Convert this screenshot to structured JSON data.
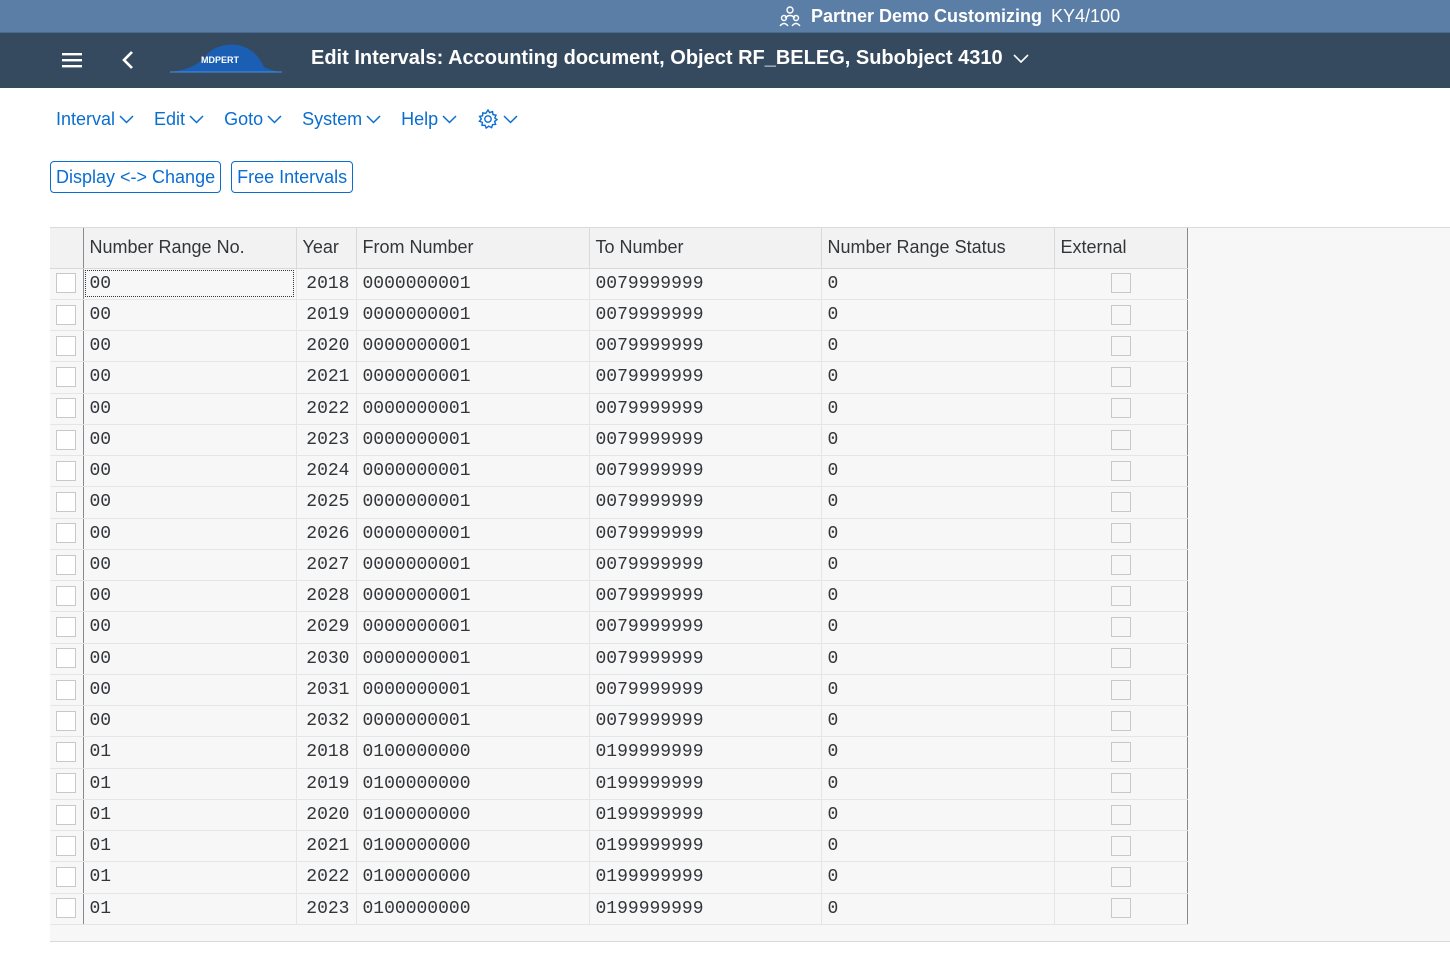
{
  "system_bar": {
    "system_name": "Partner Demo Customizing",
    "client": "KY4/100"
  },
  "shell": {
    "logo_text": "MDPERT",
    "title": "Edit Intervals: Accounting document, Object RF_BELEG, Subobject 4310"
  },
  "menu": [
    {
      "label": "Interval"
    },
    {
      "label": "Edit"
    },
    {
      "label": "Goto"
    },
    {
      "label": "System"
    },
    {
      "label": "Help"
    }
  ],
  "toolbar": {
    "display_change_label": "Display <-> Change",
    "free_intervals_label": "Free Intervals"
  },
  "table": {
    "columns": [
      "Number Range No.",
      "Year",
      "From Number",
      "To Number",
      "Number Range Status",
      "External"
    ],
    "rows": [
      [
        "00",
        "2018",
        "0000000001",
        "0079999999",
        "0"
      ],
      [
        "00",
        "2019",
        "0000000001",
        "0079999999",
        "0"
      ],
      [
        "00",
        "2020",
        "0000000001",
        "0079999999",
        "0"
      ],
      [
        "00",
        "2021",
        "0000000001",
        "0079999999",
        "0"
      ],
      [
        "00",
        "2022",
        "0000000001",
        "0079999999",
        "0"
      ],
      [
        "00",
        "2023",
        "0000000001",
        "0079999999",
        "0"
      ],
      [
        "00",
        "2024",
        "0000000001",
        "0079999999",
        "0"
      ],
      [
        "00",
        "2025",
        "0000000001",
        "0079999999",
        "0"
      ],
      [
        "00",
        "2026",
        "0000000001",
        "0079999999",
        "0"
      ],
      [
        "00",
        "2027",
        "0000000001",
        "0079999999",
        "0"
      ],
      [
        "00",
        "2028",
        "0000000001",
        "0079999999",
        "0"
      ],
      [
        "00",
        "2029",
        "0000000001",
        "0079999999",
        "0"
      ],
      [
        "00",
        "2030",
        "0000000001",
        "0079999999",
        "0"
      ],
      [
        "00",
        "2031",
        "0000000001",
        "0079999999",
        "0"
      ],
      [
        "00",
        "2032",
        "0000000001",
        "0079999999",
        "0"
      ],
      [
        "01",
        "2018",
        "0100000000",
        "0199999999",
        "0"
      ],
      [
        "01",
        "2019",
        "0100000000",
        "0199999999",
        "0"
      ],
      [
        "01",
        "2020",
        "0100000000",
        "0199999999",
        "0"
      ],
      [
        "01",
        "2021",
        "0100000000",
        "0199999999",
        "0"
      ],
      [
        "01",
        "2022",
        "0100000000",
        "0199999999",
        "0"
      ],
      [
        "01",
        "2023",
        "0100000000",
        "0199999999",
        "0"
      ]
    ]
  },
  "colors": {
    "system_bar_bg": "#5b7ea6",
    "shell_bg": "#354a5f",
    "accent": "#0a6ed1"
  }
}
